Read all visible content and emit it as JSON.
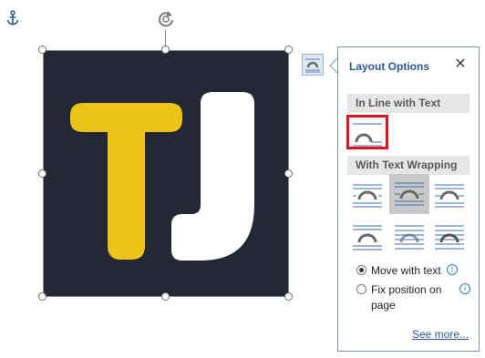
{
  "panel": {
    "title": "Layout Options",
    "close_glyph": "✕",
    "inline_section": "In Line with Text",
    "wrapping_section": "With Text Wrapping",
    "move_with_text": "Move with text",
    "fix_position_line1": "Fix position on",
    "fix_position_line2": "page",
    "see_more": "See more...",
    "info_glyph": "i",
    "move_with_text_checked": true,
    "fix_position_checked": false
  },
  "image": {
    "letter1": "T",
    "letter2": "J",
    "letter1_color": "#ECC316",
    "letter2_color": "#FFFFFF",
    "background_color": "#242834"
  },
  "icons": {
    "anchor": "anchor-icon",
    "rotate": "rotate-icon",
    "layout_options": "layout-options-icon",
    "close": "close-icon",
    "info": "info-icon"
  },
  "wrap_options": [
    "square",
    "tight",
    "through",
    "top-and-bottom",
    "behind-text",
    "in-front-of-text"
  ],
  "colors": {
    "accent": "#2B579A",
    "highlight": "#E0121E"
  }
}
